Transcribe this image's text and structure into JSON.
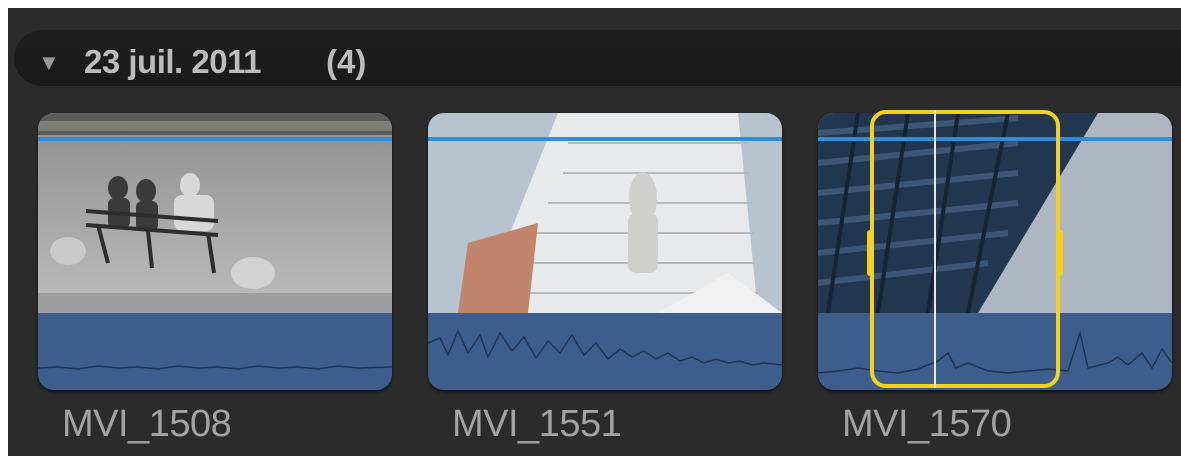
{
  "group": {
    "date": "23 juil. 2011",
    "count": "(4)",
    "disclosure_icon": "disclosure-triangle-down-icon"
  },
  "clips": [
    {
      "name": "MVI_1508"
    },
    {
      "name": "MVI_1551"
    },
    {
      "name": "MVI_1570",
      "selected": true
    }
  ],
  "colors": {
    "selection": "#f2d21f",
    "audio_track": "#3d5d8c",
    "clip_top_bar": "#2a8fe0"
  }
}
